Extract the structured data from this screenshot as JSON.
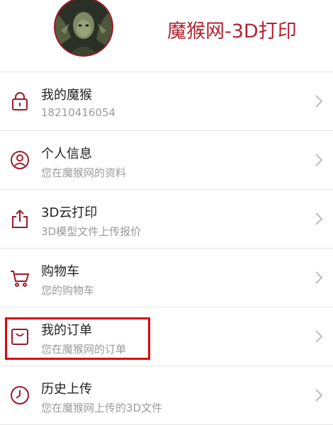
{
  "header": {
    "title": "魔猴网-3D打印",
    "avatar_icon": "profile-avatar"
  },
  "menu": {
    "items": [
      {
        "title": "我的魔猴",
        "subtitle": "18210416054",
        "icon": "lock-icon"
      },
      {
        "title": "个人信息",
        "subtitle": "您在魔猴网的资料",
        "icon": "user-icon"
      },
      {
        "title": "3D云打印",
        "subtitle": "3D模型文件上传报价",
        "icon": "upload-icon"
      },
      {
        "title": "购物车",
        "subtitle": "您的购物车",
        "icon": "cart-icon"
      },
      {
        "title": "我的订单",
        "subtitle": "您在魔猴网的订单",
        "icon": "bag-icon"
      },
      {
        "title": "历史上传",
        "subtitle": "您在魔猴网上传的3D文件",
        "icon": "clock-icon"
      }
    ]
  },
  "colors": {
    "brand": "#b32330",
    "icon": "#a01a2a",
    "highlight": "#e0060e",
    "divider": "#e4e4e4",
    "subtitle": "#9b9b9b"
  }
}
